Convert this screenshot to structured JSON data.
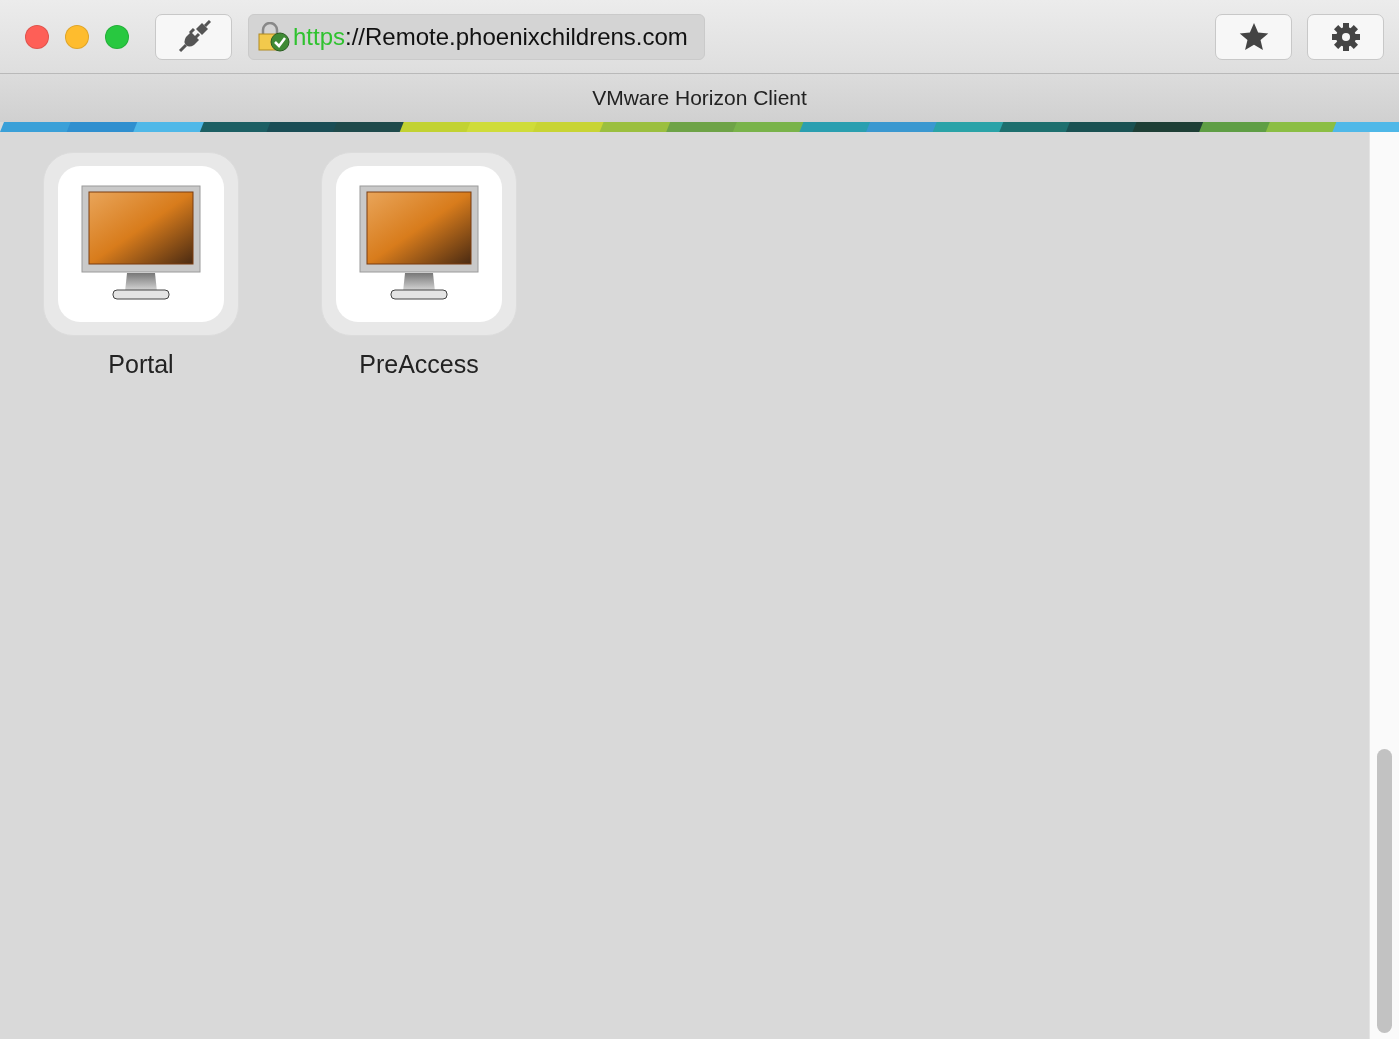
{
  "toolbar": {
    "address": {
      "scheme": "https",
      "rest": "://Remote.phoenixchildrens.com"
    }
  },
  "window": {
    "title": "VMware Horizon Client"
  },
  "desktops": [
    {
      "name": "Portal"
    },
    {
      "name": "PreAccess"
    }
  ]
}
